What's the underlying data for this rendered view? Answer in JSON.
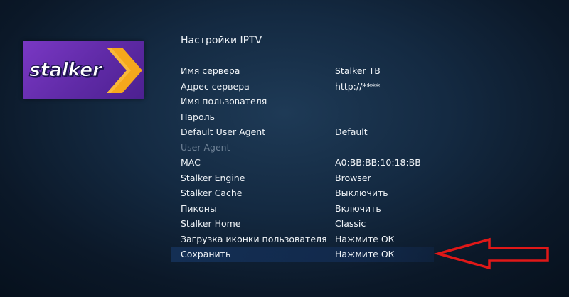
{
  "logo": {
    "text": "stalker",
    "icon": "chevron-right-icon",
    "colors": {
      "background": "#6a30b4",
      "chevron": "#f5a81c"
    }
  },
  "page": {
    "title": "Настройки IPTV"
  },
  "settings": [
    {
      "label": "Имя сервера",
      "value": "Stalker TB",
      "enabled": true
    },
    {
      "label": "Адрес сервера",
      "value": "http://****",
      "enabled": true
    },
    {
      "label": "Имя пользователя",
      "value": "",
      "enabled": true
    },
    {
      "label": "Пароль",
      "value": "",
      "enabled": true
    },
    {
      "label": "Default User Agent",
      "value": "Default",
      "enabled": true
    },
    {
      "label": "User Agent",
      "value": "",
      "enabled": false
    },
    {
      "label": "MAC",
      "value": "A0:BB:BB:10:18:BB",
      "enabled": true
    },
    {
      "label": "Stalker Engine",
      "value": "Browser",
      "enabled": true
    },
    {
      "label": "Stalker Cache",
      "value": "Выключить",
      "enabled": true
    },
    {
      "label": "Пиконы",
      "value": "Включить",
      "enabled": true
    },
    {
      "label": "Stalker Home",
      "value": "Classic",
      "enabled": true
    },
    {
      "label": "Загрузка иконки пользователя",
      "value": "Нажмите ОК",
      "enabled": true
    },
    {
      "label": "Сохранить",
      "value": "Нажмите ОК",
      "enabled": true,
      "selected": true
    }
  ],
  "annotation": {
    "icon": "red-arrow-left-icon",
    "color": "#e01818"
  }
}
